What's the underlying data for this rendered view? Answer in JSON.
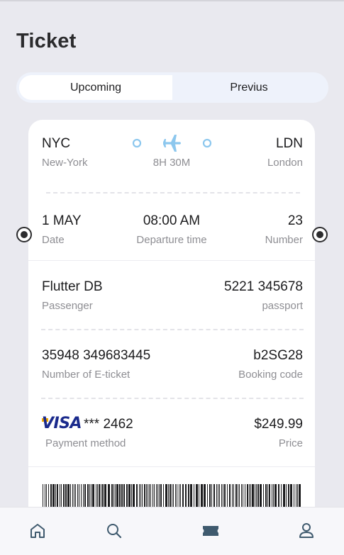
{
  "header": {
    "title": "Ticket"
  },
  "tabs": [
    {
      "label": "Upcoming",
      "active": true
    },
    {
      "label": "Previus",
      "active": false
    }
  ],
  "route": {
    "from_code": "NYC",
    "from_city": "New-York",
    "to_code": "LDN",
    "to_city": "London",
    "duration": "8H 30M"
  },
  "flight": {
    "date": "1 MAY",
    "date_label": "Date",
    "departure_time": "08:00 AM",
    "departure_label": "Departure time",
    "number": "23",
    "number_label": "Number"
  },
  "passenger": {
    "name": "Flutter DB",
    "name_label": "Passenger",
    "passport": "5221 345678",
    "passport_label": "passport"
  },
  "ticket": {
    "eticket": "35948 349683445",
    "eticket_label": "Number of E-ticket",
    "booking_code": "b2SG28",
    "booking_label": "Booking code"
  },
  "payment": {
    "card_brand": "VISA",
    "card_masked": "*** 2462",
    "method_label": "Payment method",
    "price": "$249.99",
    "price_label": "Price"
  },
  "colors": {
    "accent": "#8cc7ee",
    "background": "#e9e9ef",
    "card": "#ffffff",
    "muted_text": "#8e8e93",
    "nav_active": "#3f5a6e"
  },
  "nav": [
    {
      "icon": "home-icon"
    },
    {
      "icon": "search-icon"
    },
    {
      "icon": "ticket-icon",
      "active": true
    },
    {
      "icon": "profile-icon"
    }
  ]
}
